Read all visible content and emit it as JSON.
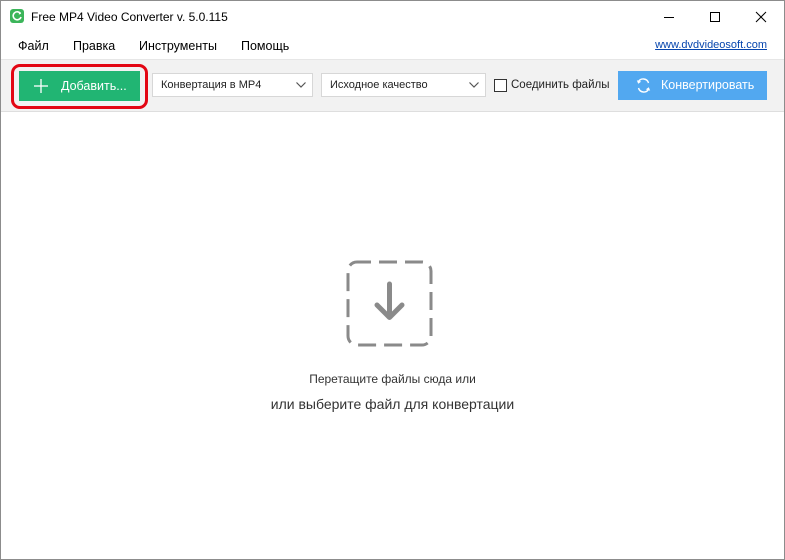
{
  "window": {
    "title": "Free MP4 Video Converter v. 5.0.115"
  },
  "menu": {
    "items": [
      "Файл",
      "Правка",
      "Инструменты",
      "Помощь"
    ],
    "link": "www.dvdvideosoft.com"
  },
  "toolbar": {
    "add_label": "Добавить...",
    "conversion_value": "Конвертация в MP4",
    "quality_value": "Исходное качество",
    "join_label": "Соединить файлы",
    "join_checked": false,
    "convert_label": "Конвертировать"
  },
  "drop_area": {
    "line1": "Перетащите файлы сюда или",
    "line2": "или выберите файл для конвертации"
  },
  "colors": {
    "add_button": "#21b573",
    "convert_button": "#52a8f0",
    "highlight": "#e30613",
    "link": "#0645ad"
  },
  "icons": {
    "app": "refresh-icon",
    "add": "plus-icon",
    "convert": "refresh-icon",
    "drop": "download-arrow-icon"
  }
}
